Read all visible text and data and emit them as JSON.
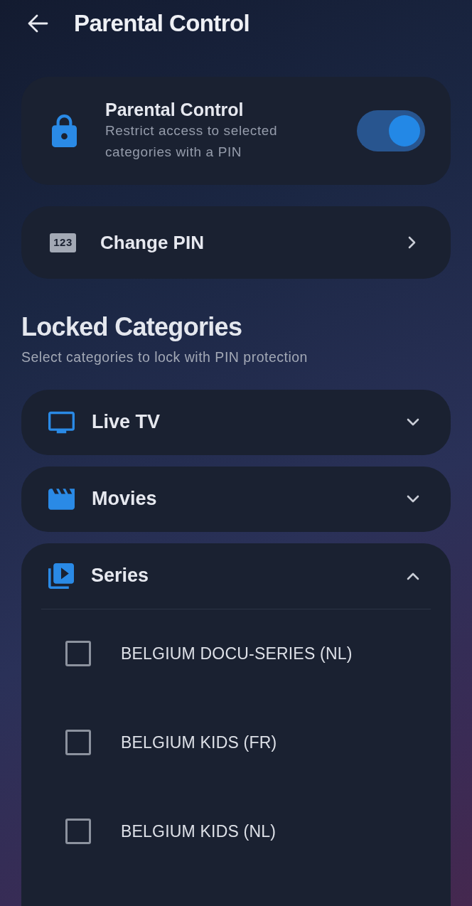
{
  "header": {
    "title": "Parental Control"
  },
  "parental_control": {
    "title": "Parental Control",
    "description": "Restrict access to selected categories with a PIN",
    "on": true
  },
  "change_pin": {
    "icon_text": "123",
    "label": "Change PIN"
  },
  "locked_categories": {
    "title": "Locked Categories",
    "subtitle": "Select categories to lock with PIN protection",
    "categories": [
      {
        "kind": "tv",
        "label": "Live TV",
        "expanded": false
      },
      {
        "kind": "movies",
        "label": "Movies",
        "expanded": false
      },
      {
        "kind": "series",
        "label": "Series",
        "expanded": true,
        "items": [
          {
            "label": "BELGIUM DOCU-SERIES (NL)",
            "checked": false
          },
          {
            "label": "BELGIUM KIDS (FR)",
            "checked": false
          },
          {
            "label": "BELGIUM KIDS (NL)",
            "checked": false
          }
        ]
      }
    ]
  }
}
